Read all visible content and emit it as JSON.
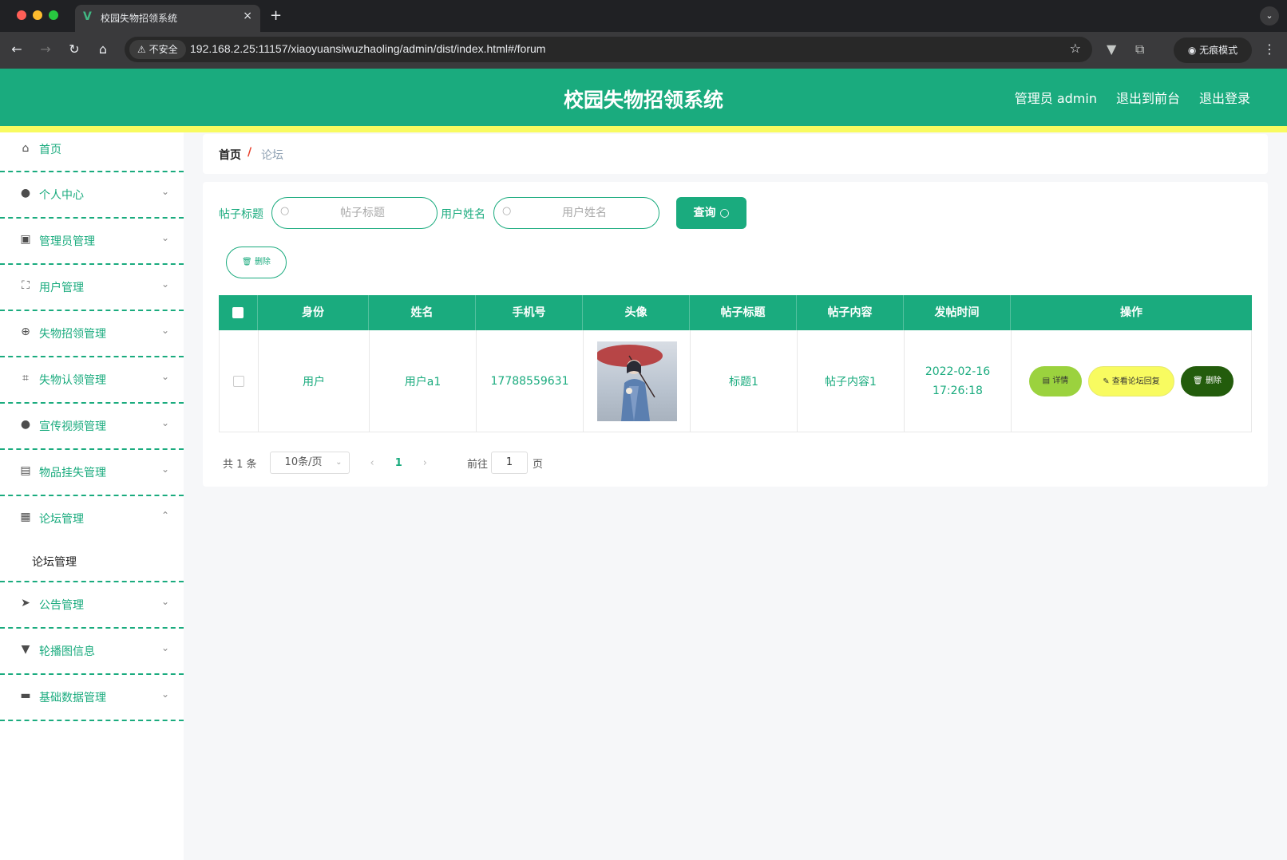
{
  "browser": {
    "tab_title": "校园失物招领系统",
    "tab_close": "×",
    "new_tab": "+",
    "insecure_label": "不安全",
    "url": "192.168.2.25:11157/xiaoyuansiwuzhaoling/admin/dist/index.html#/forum",
    "incognito_label": "无痕模式"
  },
  "header": {
    "title": "校园失物招领系统",
    "admin_label": "管理员 admin",
    "back_front_label": "退出到前台",
    "logout_label": "退出登录"
  },
  "sidebar": {
    "items": [
      {
        "label": "首页",
        "icon": "home-icon"
      },
      {
        "label": "个人中心",
        "icon": "user-icon"
      },
      {
        "label": "管理员管理",
        "icon": "clipboard-icon"
      },
      {
        "label": "用户管理",
        "icon": "fullscreen-icon"
      },
      {
        "label": "失物招领管理",
        "icon": "target-icon"
      },
      {
        "label": "失物认领管理",
        "icon": "crop-icon"
      },
      {
        "label": "宣传视频管理",
        "icon": "user-icon"
      },
      {
        "label": "物品挂失管理",
        "icon": "briefcase-icon"
      },
      {
        "label": "论坛管理",
        "icon": "grid-icon"
      },
      {
        "label": "公告管理",
        "icon": "send-icon"
      },
      {
        "label": "轮播图信息",
        "icon": "brush-icon"
      },
      {
        "label": "基础数据管理",
        "icon": "ticket-icon"
      }
    ],
    "submenu_forum": "论坛管理"
  },
  "breadcrumb": {
    "home": "首页",
    "separator": "/",
    "current": "论坛"
  },
  "search": {
    "title_label": "帖子标题",
    "title_placeholder": "帖子标题",
    "name_label": "用户姓名",
    "name_placeholder": "用户姓名",
    "query_button": "查询",
    "delete_button": "删除"
  },
  "table": {
    "headers": [
      "身份",
      "姓名",
      "手机号",
      "头像",
      "帖子标题",
      "帖子内容",
      "发帖时间",
      "操作"
    ],
    "rows": [
      {
        "identity": "用户",
        "name": "用户a1",
        "phone": "17788559631",
        "title": "标题1",
        "content": "帖子内容1",
        "time": "2022-02-16 17:26:18",
        "detail_button": "详情",
        "reply_button": "查看论坛回复",
        "delete_button": "删除"
      }
    ]
  },
  "pagination": {
    "total": "共 1 条",
    "page_size": "10条/页",
    "current_page": "1",
    "goto_label": "前往",
    "goto_value": "1",
    "page_unit": "页"
  },
  "colors": {
    "primary": "#1aab7e",
    "accent_yellow": "#f8fb60",
    "detail_green": "#9bd23e",
    "delete_dark_green": "#235c0c"
  }
}
